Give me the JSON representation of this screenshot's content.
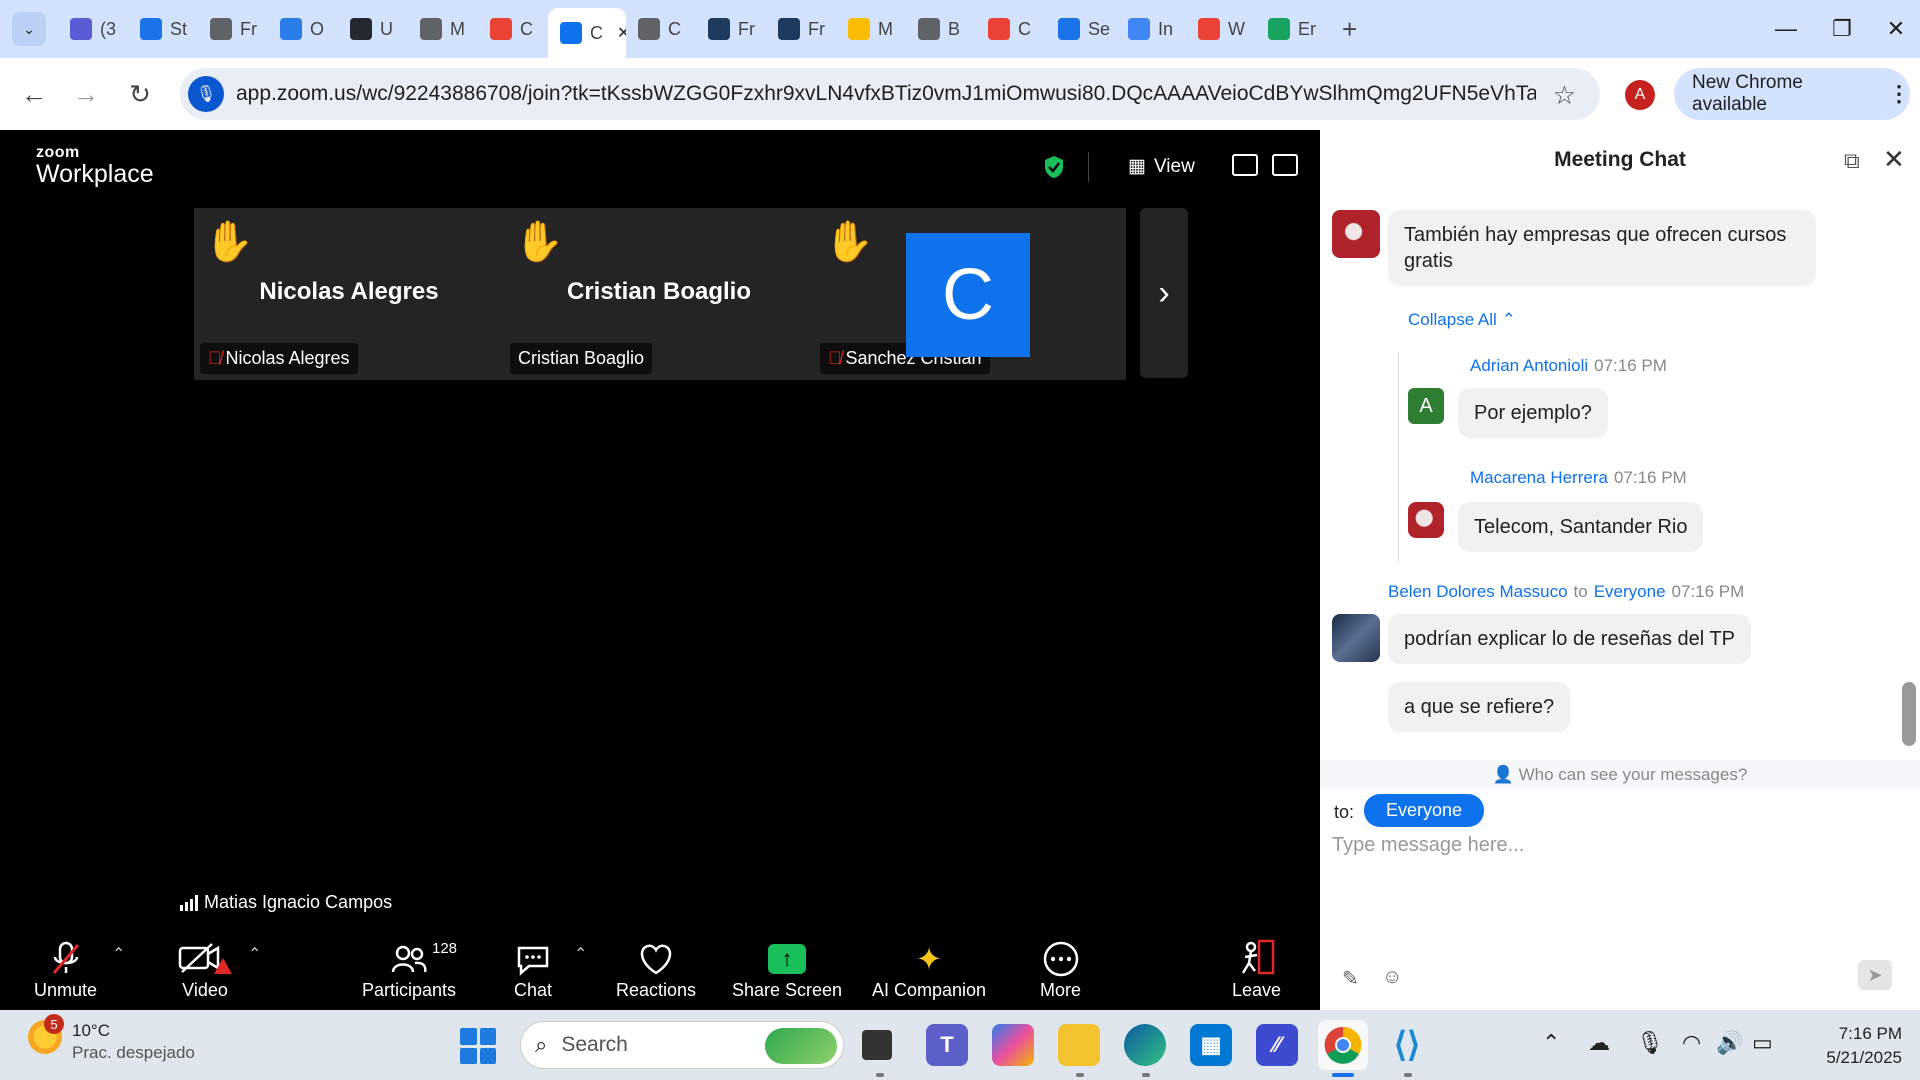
{
  "browser": {
    "tabs": [
      {
        "label": "(3",
        "icon": "app-icon",
        "color": "#5b5bd6"
      },
      {
        "label": "St",
        "icon": "flag-icon",
        "color": "#1a73e8"
      },
      {
        "label": "Fr",
        "icon": "tab-icon",
        "color": "#5f6368"
      },
      {
        "label": "O",
        "icon": "copilot-icon",
        "color": "#2b7de9"
      },
      {
        "label": "U",
        "icon": "github-icon",
        "color": "#24292f"
      },
      {
        "label": "M",
        "icon": "globe-icon",
        "color": "#5f6368"
      },
      {
        "label": "C",
        "icon": "gmail-icon",
        "color": "#ea4335"
      },
      {
        "label": "C",
        "icon": "zoom-icon",
        "color": "#0e72ed"
      },
      {
        "label": "C",
        "icon": "tab-icon",
        "color": "#5f6368"
      },
      {
        "label": "Fr",
        "icon": "terminal-icon",
        "color": "#1e3a5f"
      },
      {
        "label": "Fr",
        "icon": "terminal-icon",
        "color": "#1e3a5f"
      },
      {
        "label": "M",
        "icon": "drive-icon",
        "color": "#fbbc04"
      },
      {
        "label": "B",
        "icon": "globe-icon",
        "color": "#5f6368"
      },
      {
        "label": "C",
        "icon": "gmail-icon",
        "color": "#ea4335"
      },
      {
        "label": "Se",
        "icon": "flag-icon",
        "color": "#1a73e8"
      },
      {
        "label": "In",
        "icon": "docs-icon",
        "color": "#4285f4"
      },
      {
        "label": "W",
        "icon": "gmail-icon",
        "color": "#ea4335"
      },
      {
        "label": "Er",
        "icon": "ed-icon",
        "color": "#1aa260"
      }
    ],
    "url": "app.zoom.us/wc/92243886708/join?tk=tKssbWZGG0Fzxhr9xvLN4vfxBTiz0vmJ1miOmwusi80.DQcAAAAVeioCdBYwSlhmQmg2UFN5eVhTa28...",
    "profile_initial": "A",
    "new_chrome": "New Chrome available"
  },
  "zoom": {
    "logo_top": "zoom",
    "logo_bottom": "Workplace",
    "view_label": "View",
    "participants": [
      {
        "name": "Nicolas Alegres",
        "label": "Nicolas Alegres",
        "muted": true
      },
      {
        "name": "Cristian Boaglio",
        "label": "Cristian Boaglio",
        "muted": false
      },
      {
        "name": "",
        "label": "Sanchez Cristian",
        "muted": true,
        "avatar": "C"
      }
    ],
    "self_name": "Matias Ignacio Campos",
    "controls": {
      "unmute": "Unmute",
      "video": "Video",
      "participants": "Participants",
      "participants_count": "128",
      "chat": "Chat",
      "reactions": "Reactions",
      "share": "Share Screen",
      "ai": "AI Companion",
      "more": "More",
      "leave": "Leave"
    }
  },
  "chat": {
    "title": "Meeting Chat",
    "messages": {
      "m1": "También hay empresas que ofrecen cursos gratis",
      "collapse": "Collapse All",
      "r1_sender": "Adrian Antonioli",
      "r1_time": "07:16 PM",
      "r1_initial": "A",
      "r1_text": "Por ejemplo?",
      "r2_sender": "Macarena Herrera",
      "r2_time": "07:16 PM",
      "r2_text": "Telecom, Santander Rio",
      "m2_sender": "Belen Dolores Massuco",
      "m2_to_word": "to",
      "m2_to": "Everyone",
      "m2_time": "07:16 PM",
      "m2_text": "podrían explicar lo de reseñas del TP",
      "m3_text": "a que se refiere?"
    },
    "who_can_see": "Who can see your messages?",
    "to_label": "to:",
    "to_value": "Everyone",
    "input_placeholder": "Type message here..."
  },
  "taskbar": {
    "temp": "10°C",
    "weather": "Prac. despejado",
    "weather_badge": "5",
    "search": "Search",
    "time": "7:16 PM",
    "date": "5/21/2025"
  }
}
